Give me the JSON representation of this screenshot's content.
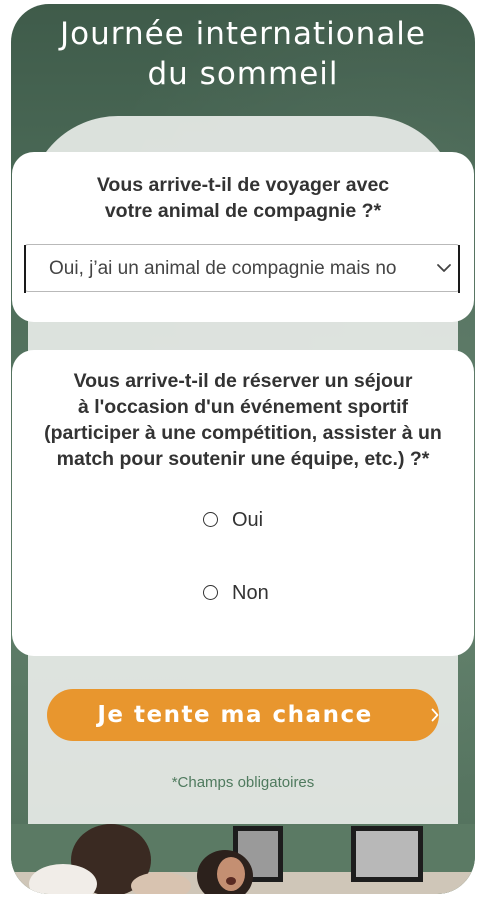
{
  "header": {
    "title_line1": "Journée internationale",
    "title_line2": "du sommeil"
  },
  "question1": {
    "label_line1": "Vous arrive-t-il de voyager avec",
    "label_line2": "votre animal de compagnie ?*",
    "selected_value": "Oui, j’ai un animal de compagnie mais no"
  },
  "question2": {
    "label_line1": "Vous arrive-t-il de réserver un séjour",
    "label_line2": "à l'occasion d'un événement sportif",
    "label_line3": "(participer à une compétition, assister à un",
    "label_line4": "match pour soutenir une équipe, etc.) ?*",
    "options": [
      {
        "label": "Oui",
        "checked": false
      },
      {
        "label": "Non",
        "checked": false
      }
    ]
  },
  "cta": {
    "label": "Je tente ma chance",
    "arrow_icon": "chevron-right-icon"
  },
  "footer": {
    "required_note": "*Champs obligatoires"
  },
  "colors": {
    "background_green": "#4a6956",
    "accent_orange": "#e8962e",
    "note_green": "#4f7a5e",
    "text_dark": "#333333"
  }
}
